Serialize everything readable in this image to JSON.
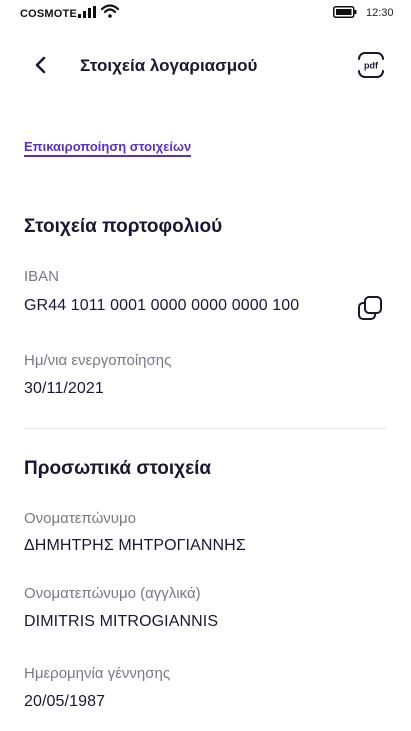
{
  "status_bar": {
    "carrier": "COSMOTE",
    "time": "12:30"
  },
  "header": {
    "title": "Στοιχεία λογαριασμού",
    "back_icon": "chevron-left-icon",
    "pdf_icon_label": "pdf"
  },
  "update_link": "Επικαιροποίηση στοιχείων",
  "wallet": {
    "title": "Στοιχεία πορτοφολιού",
    "iban_label": "IBAN",
    "iban_value": "GR44 1011 0001 0000 0000 0000 100",
    "copy_icon": "copy-icon",
    "activation_label": "Ημ/νια ενεργοποίησης",
    "activation_value": "30/11/2021"
  },
  "personal": {
    "title": "Προσωπικά στοιχεία",
    "fullname_label": "Ονοματεπώνυμο",
    "fullname_value": "ΔΗΜΗΤΡΗΣ ΜΗΤΡΟΓΙΑΝΝΗΣ",
    "fullname_en_label": "Ονοματεπώνυμο (αγγλικά)",
    "fullname_en_value": "DIMITRIS MITROGIANNIS",
    "birthdate_label": "Ημερομηνία γέννησης",
    "birthdate_value": "20/05/1987"
  },
  "colors": {
    "accent": "#5b2ccf",
    "text_primary": "#1c1533",
    "text_secondary": "#7b7785",
    "divider": "#e6e4ea"
  }
}
